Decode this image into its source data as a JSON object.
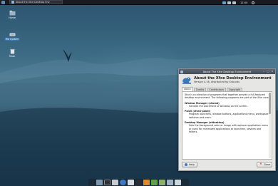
{
  "top_panel": {
    "window_button_label": "About the Xfce Desktop Env",
    "clock": "12:00"
  },
  "desktop_icons": [
    {
      "label": "Home",
      "icon": "home-folder-icon"
    },
    {
      "label": "File System",
      "icon": "drive-icon"
    },
    {
      "label": "Trash",
      "icon": "trash-icon"
    }
  ],
  "about": {
    "window_title": "About The Xfce Desktop Environment",
    "heading": "About the Xfce Desktop Environment",
    "version": "Version 4.16, distributed by Xubuntu",
    "tabs": [
      "About",
      "Credits",
      "Contributors",
      "Copyright"
    ],
    "intro": "Xfce is a collection of programs that together provide a full-featured desktop environment. The following programs are part of the Xfce core:",
    "sections": [
      {
        "title": "Window Manager (xfwm4)",
        "desc": "Handles the placement of windows on the screen."
      },
      {
        "title": "Panel (xfce4-panel)",
        "desc": "Program launchers, window buttons, applications menu, workspace switcher and more."
      },
      {
        "title": "Desktop Manager (xfdesktop)",
        "desc": "Sets the background color or image with optional application menu or icons for minimized applications or launchers, devices and folders."
      }
    ],
    "help_label": "Help",
    "close_label": "Close"
  },
  "colors": {
    "panel": "#191b1f",
    "selection": "#3d78b8",
    "wallpaper_top": "#2d5671",
    "wallpaper_bottom": "#17344a"
  },
  "dock_items": [
    "show-desktop-icon",
    "terminal-icon",
    "file-manager-icon",
    "web-browser-icon",
    "mail-icon",
    "app-finder-icon",
    "settings-icon",
    "image-icon",
    "media-icon",
    "folder-icon",
    "trash-icon"
  ]
}
